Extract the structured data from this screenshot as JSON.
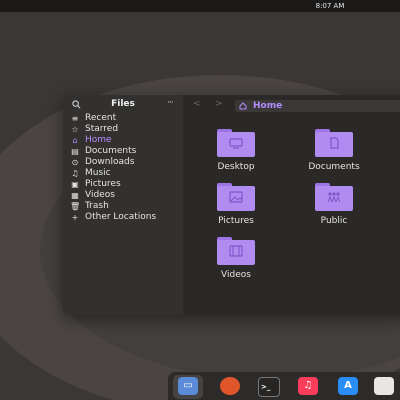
{
  "topbar": {
    "clock": "8:07 AM"
  },
  "sidebar": {
    "title": "Files",
    "items": [
      {
        "label": "Recent",
        "icon": "≡",
        "active": false
      },
      {
        "label": "Starred",
        "icon": "☆",
        "active": false
      },
      {
        "label": "Home",
        "icon": "⌂",
        "active": true
      },
      {
        "label": "Documents",
        "icon": "▤",
        "active": false
      },
      {
        "label": "Downloads",
        "icon": "⊙",
        "active": false
      },
      {
        "label": "Music",
        "icon": "♫",
        "active": false
      },
      {
        "label": "Pictures",
        "icon": "▣",
        "active": false
      },
      {
        "label": "Videos",
        "icon": "▦",
        "active": false
      },
      {
        "label": "Trash",
        "icon": "🗑",
        "active": false
      },
      {
        "label": "Other Locations",
        "icon": "+",
        "active": false
      }
    ]
  },
  "pathbar": {
    "location": "Home"
  },
  "folders": [
    {
      "label": "Desktop",
      "emblem": "desktop"
    },
    {
      "label": "Documents",
      "emblem": "document"
    },
    {
      "label": "Pictures",
      "emblem": "picture"
    },
    {
      "label": "Public",
      "emblem": "people"
    },
    {
      "label": "Videos",
      "emblem": "film"
    }
  ],
  "dock": {
    "apps": [
      "files",
      "firefox",
      "terminal",
      "music",
      "app-store",
      "text-editor"
    ]
  },
  "colors": {
    "accent": "#b38cff",
    "folder": "#b08cf0",
    "window_bg": "#2a2928",
    "sidebar_bg": "#323130"
  }
}
